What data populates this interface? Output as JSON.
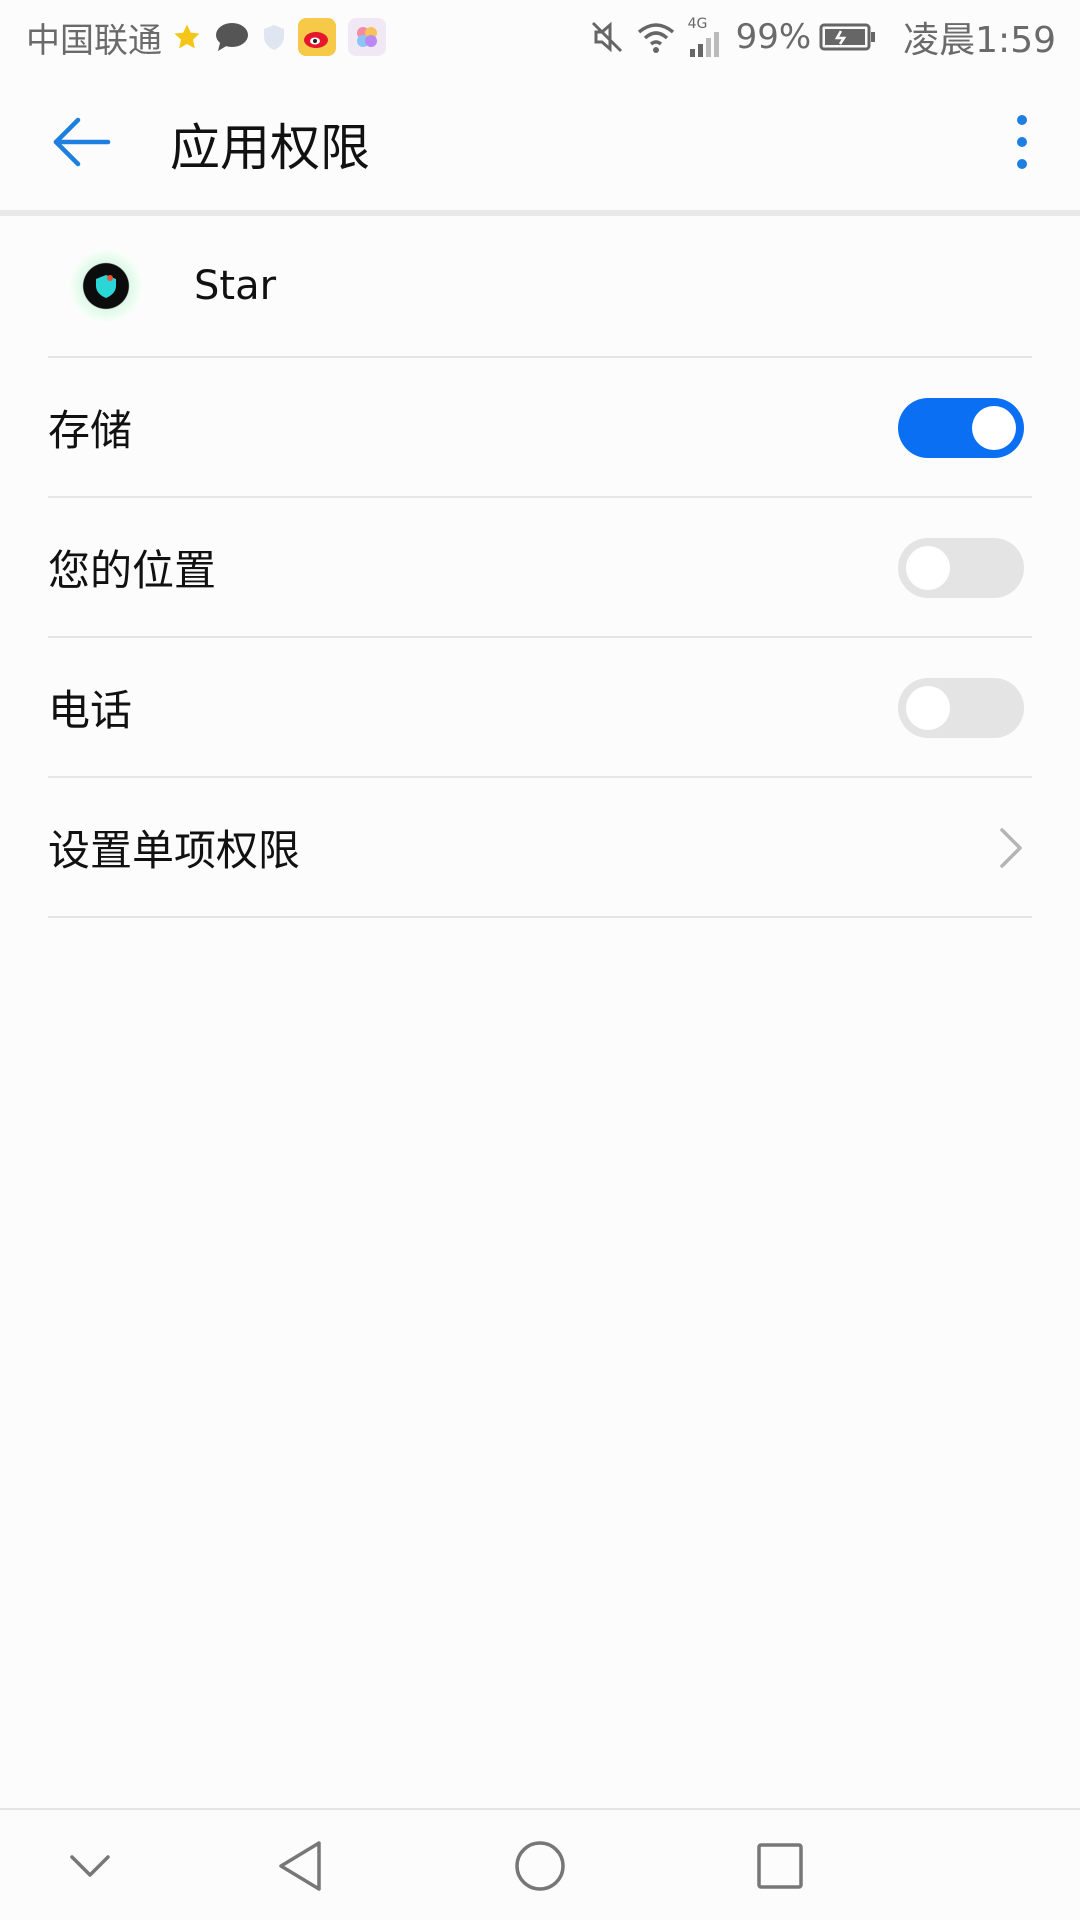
{
  "status_bar": {
    "carrier": "中国联通",
    "battery_percent": "99%",
    "time": "凌晨1:59",
    "network": "4G",
    "icons": [
      "star-icon",
      "chat-icon",
      "shield-icon",
      "weibo-icon",
      "flower-app-icon",
      "mute-icon",
      "wifi-icon",
      "signal-icon",
      "battery-icon"
    ]
  },
  "app_bar": {
    "title": "应用权限",
    "back_icon": "back-arrow-icon",
    "more_icon": "more-vertical-icon"
  },
  "app": {
    "name": "Star",
    "icon": "star-app-icon"
  },
  "permissions": [
    {
      "label": "存储",
      "enabled": true
    },
    {
      "label": "您的位置",
      "enabled": false
    },
    {
      "label": "电话",
      "enabled": false
    }
  ],
  "individual_permissions": {
    "label": "设置单项权限",
    "icon": "chevron-right-icon"
  },
  "colors": {
    "accent": "#0a6ff2",
    "toggle_off": "#e4e4e4",
    "background": "#fcfcfc"
  },
  "nav_bar": {
    "icons": [
      "collapse-down-icon",
      "back-triangle-icon",
      "home-circle-icon",
      "recents-square-icon"
    ]
  }
}
